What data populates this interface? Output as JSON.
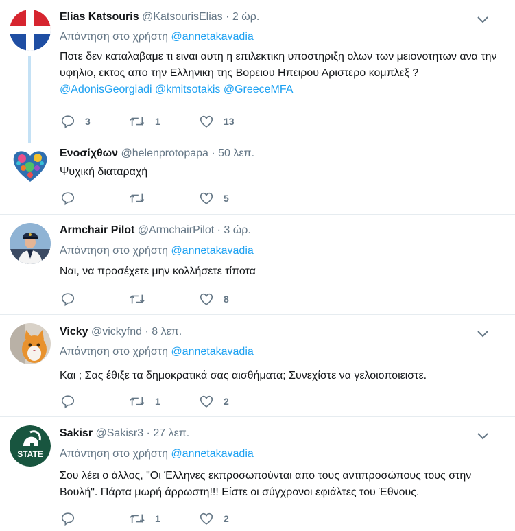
{
  "reply_prefix": "Απάντηση στο χρήστη",
  "colors": {
    "accent": "#1da1f2",
    "muted": "#657786",
    "text": "#14171a",
    "divider": "#e6ecf0",
    "thread": "#c4e1f5"
  },
  "tweets": [
    {
      "name": "Elias Katsouris",
      "handle": "@KatsourisElias",
      "time": "2 ώρ.",
      "reply_to": "@annetakavadia",
      "text_parts": [
        "Ποτε δεν καταλαβαμε τι ειναι αυτη η επιλεκτικη υποστηριξη ολων των μειονοτητων ανα την υφηλιο, εκτος απο την Ελληνικη της Βορειου Ηπειρου Αριστερο κομπλεξ ? ",
        "@AdonisGeorgiadi",
        " ",
        "@kmitsotakis",
        " ",
        "@GreeceMFA"
      ],
      "replies": "3",
      "retweets": "1",
      "likes": "13",
      "avatar_icon": "flag-avatar-icon"
    },
    {
      "name": "Ενοσίχθων",
      "handle": "@helenprotopapa",
      "time": "50 λεπ.",
      "text": "Ψυχική διαταραχή",
      "replies": "",
      "retweets": "",
      "likes": "5",
      "avatar_icon": "heart-mosaic-avatar-icon"
    },
    {
      "name": "Armchair Pilot",
      "handle": "@ArmchairPilot",
      "time": "3 ώρ.",
      "reply_to": "@annetakavadia",
      "text": "Ναι, να προσέχετε μην κολλήσετε τίποτα",
      "replies": "",
      "retweets": "",
      "likes": "8",
      "avatar_icon": "pilot-avatar-icon"
    },
    {
      "name": "Vicky",
      "handle": "@vickyfnd",
      "time": "8 λεπ.",
      "reply_to": "@annetakavadia",
      "text": "Και ; Σας έθιξε τα δημοκρατικά σας αισθήματα; Συνεχίστε να γελοιοποιειστε.",
      "replies": "",
      "retweets": "1",
      "likes": "2",
      "avatar_icon": "cat-avatar-icon"
    },
    {
      "name": "Sakisr",
      "handle": "@Sakisr3",
      "time": "27 λεπ.",
      "reply_to": "@annetakavadia",
      "text": "Σου λέει ο άλλος, \"Οι Έλληνες εκπροσωπούνται απο τους αντιπροσώπους τους στην Βουλή\". Πάρτα μωρή άρρωστη!!! Είστε οι σύγχρονοι εφιάλτες του Έθνους.",
      "replies": "",
      "retweets": "1",
      "likes": "2",
      "avatar_icon": "spartan-state-avatar-icon",
      "avatar_label": "STATE"
    }
  ]
}
